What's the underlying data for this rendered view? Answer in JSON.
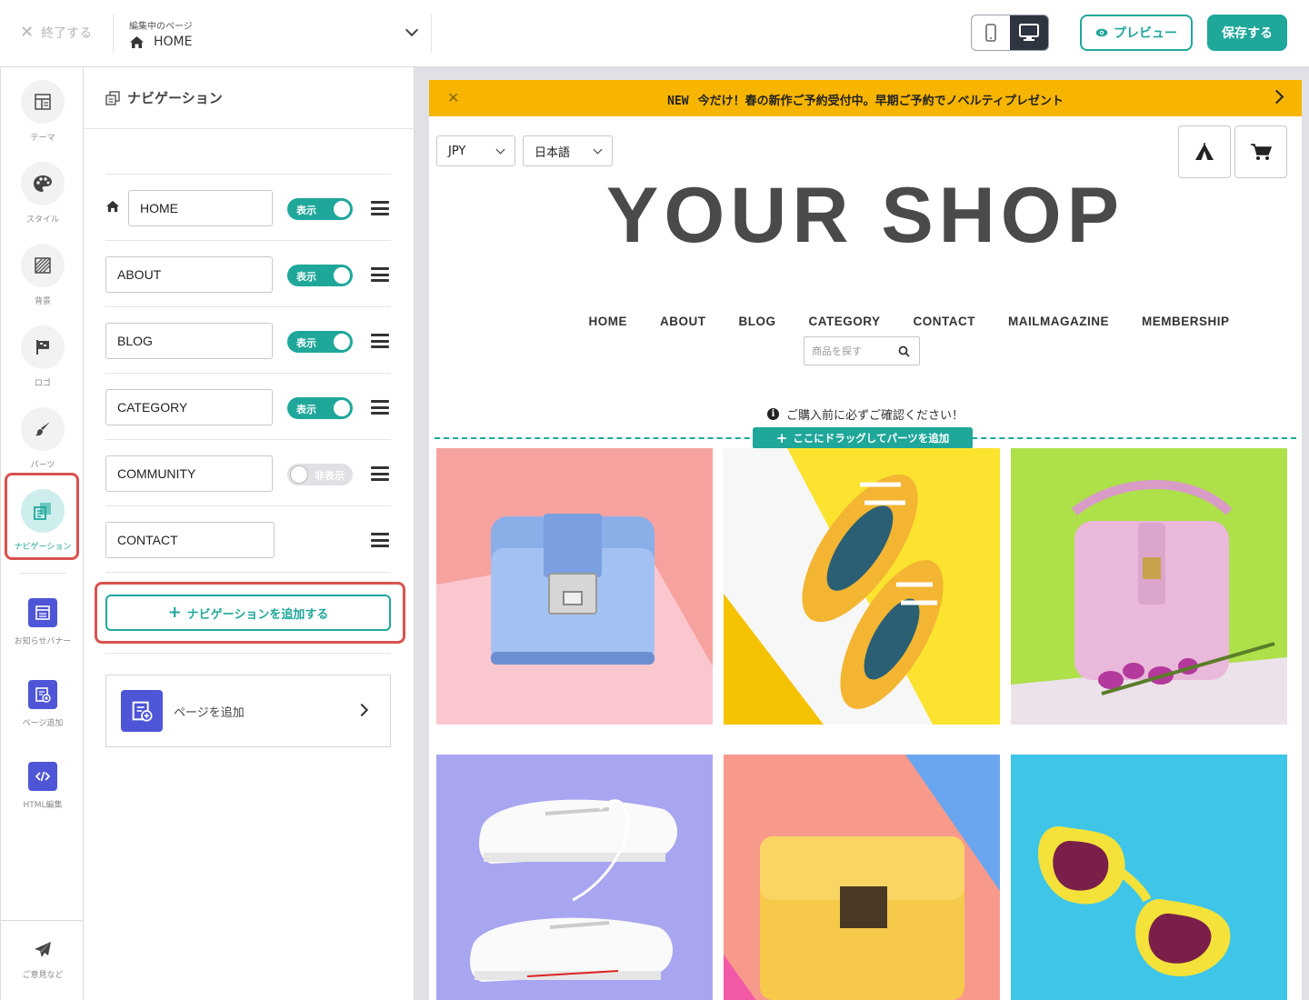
{
  "topbar": {
    "exit_label": "終了する",
    "page_caption": "編集中のページ",
    "current_page": "HOME",
    "preview_label": "プレビュー",
    "save_label": "保存する"
  },
  "rail": {
    "items": [
      {
        "label": "テーマ"
      },
      {
        "label": "スタイル"
      },
      {
        "label": "背景"
      },
      {
        "label": "ロゴ"
      },
      {
        "label": "パーツ"
      },
      {
        "label": "ナビゲーション"
      },
      {
        "label": "お知らせバナー"
      },
      {
        "label": "ページ追加"
      },
      {
        "label": "HTML編集"
      }
    ],
    "feedback_label": "ご意見など"
  },
  "panel": {
    "title": "ナビゲーション",
    "items": [
      {
        "label": "HOME",
        "toggle": "表示",
        "visible": true
      },
      {
        "label": "ABOUT",
        "toggle": "表示",
        "visible": true
      },
      {
        "label": "BLOG",
        "toggle": "表示",
        "visible": true
      },
      {
        "label": "CATEGORY",
        "toggle": "表示",
        "visible": true
      },
      {
        "label": "COMMUNITY",
        "toggle": "非表示",
        "visible": false
      },
      {
        "label": "CONTACT"
      }
    ],
    "add_nav_label": "ナビゲーションを追加する",
    "add_page_label": "ページを追加"
  },
  "site": {
    "banner": {
      "tag": "NEW",
      "text": "今だけ！春の新作ご予約受付中。早期ご予約でノベルティプレゼント"
    },
    "currency": "JPY",
    "language": "日本語",
    "logo": "YOUR SHOP",
    "nav": [
      "HOME",
      "ABOUT",
      "BLOG",
      "CATEGORY",
      "CONTACT",
      "MAILMAGAZINE",
      "MEMBERSHIP"
    ],
    "search_placeholder": "商品を探す",
    "notice": "ご購入前に必ずご確認ください！",
    "drop_label": "ここにドラッグしてパーツを追加"
  },
  "colors": {
    "accent": "#1fa79a",
    "highlight": "#d9534f",
    "banner": "#f7b500",
    "rail_icon": "#4e55d6"
  }
}
